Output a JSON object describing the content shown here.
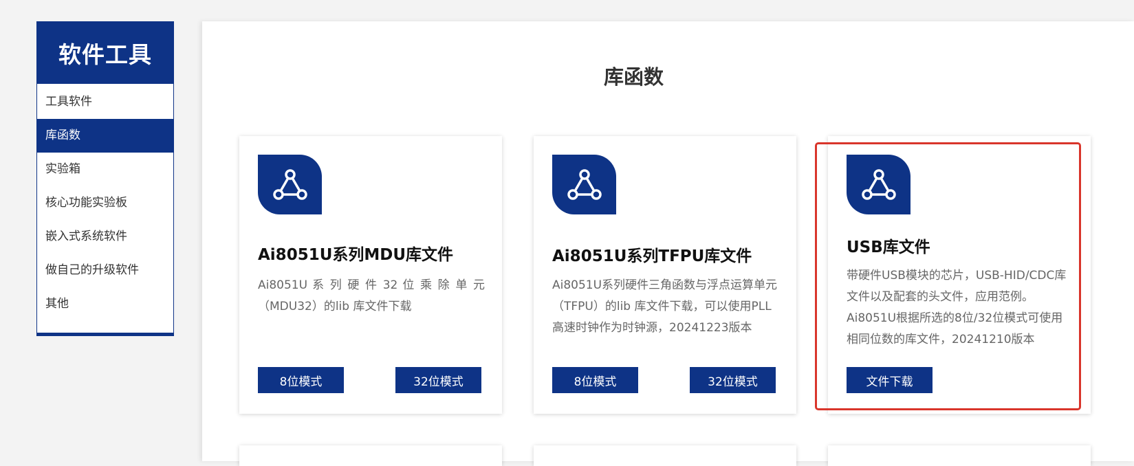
{
  "sidebar": {
    "title": "软件工具",
    "items": [
      {
        "label": "工具软件",
        "active": false
      },
      {
        "label": "库函数",
        "active": true
      },
      {
        "label": "实验箱",
        "active": false
      },
      {
        "label": "核心功能实验板",
        "active": false
      },
      {
        "label": "嵌入式系统软件",
        "active": false
      },
      {
        "label": "做自己的升级软件",
        "active": false
      },
      {
        "label": "其他",
        "active": false
      }
    ]
  },
  "main": {
    "title": "库函数",
    "cards": [
      {
        "icon": "share-network-icon",
        "title": "Ai8051U系列MDU库文件",
        "desc_line1": "Ai8051U 系 列 硬 件 32 位 乘 除 单 元",
        "desc_line2": "（MDU32）的lib 库文件下载",
        "buttons": [
          "8位模式",
          "32位模式"
        ]
      },
      {
        "icon": "share-network-icon",
        "title": "Ai8051U系列TFPU库文件",
        "desc": "Ai8051U系列硬件三角函数与浮点运算单元（TFPU）的lib 库文件下载，可以使用PLL高速时钟作为时钟源，20241223版本",
        "buttons": [
          "8位模式",
          "32位模式"
        ]
      },
      {
        "icon": "share-network-icon",
        "title": "USB库文件",
        "desc": "带硬件USB模块的芯片，USB-HID/CDC库文件以及配套的头文件，应用范例。Ai8051U根据所选的8位/32位模式可使用相同位数的库文件，20241210版本",
        "buttons": [
          "文件下载"
        ]
      }
    ]
  },
  "colors": {
    "brand": "#0e3386",
    "highlight": "#d9352b"
  }
}
